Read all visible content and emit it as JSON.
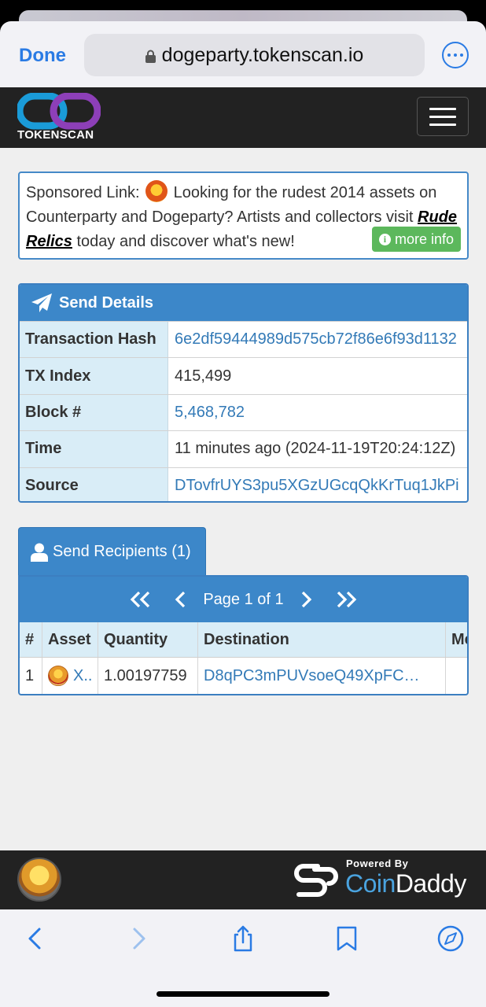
{
  "browser": {
    "done_label": "Done",
    "url": "dogeparty.tokenscan.io",
    "accent": "#2a7be4"
  },
  "site": {
    "logo_text": "TOKENSCAN"
  },
  "sponsor": {
    "prefix": "Sponsored Link:",
    "text_1": "Looking for the rudest 2014 assets on Counterparty and Dogeparty? Artists and collectors visit",
    "link": "Rude Relics",
    "text_2": "today and discover what's new!",
    "more_info": "more info"
  },
  "send_details": {
    "title": "Send Details",
    "rows": [
      {
        "key": "Transaction Hash",
        "value": "6e2df59444989d575cb72f86e6f93d1132"
      },
      {
        "key": "TX Index",
        "value": "415,499"
      },
      {
        "key": "Block #",
        "value": "5,468,782"
      },
      {
        "key": "Time",
        "value": "11 minutes ago (2024-11-19T20:24:12Z)"
      },
      {
        "key": "Source",
        "value": "DTovfrUYS3pu5XGzUGcqQkKrTuq1JkPi"
      }
    ]
  },
  "recipients": {
    "tab_label": "Send Recipients (1)",
    "pager": {
      "label": "Page 1 of 1"
    },
    "columns": [
      "#",
      "Asset",
      "Quantity",
      "Destination",
      "Me"
    ],
    "rows": [
      {
        "num": "1",
        "asset": "X..",
        "quantity": "1.00197759",
        "destination": "D8qPC3mPUVsoeQ49XpFC…",
        "memo": ""
      }
    ]
  },
  "footer": {
    "powered_by": "Powered By",
    "brand_a": "Coin",
    "brand_b": "Daddy"
  },
  "colors": {
    "panel_blue": "#3c87c9",
    "link_blue": "#337ab7",
    "header_cell": "#d9edf7",
    "more_info_green": "#5cb85c"
  }
}
